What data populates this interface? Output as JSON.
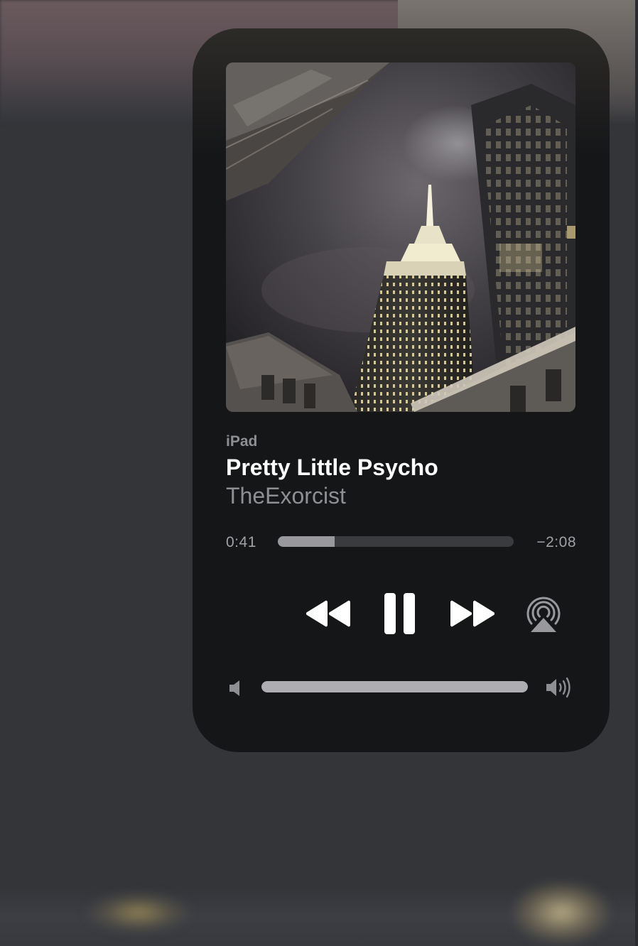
{
  "now_playing": {
    "device": "iPad",
    "title": "Pretty Little Psycho",
    "artist": "TheExorcist",
    "artwork": "night-skyscraper-photo"
  },
  "playback": {
    "elapsed": "0:41",
    "remaining": "−2:08",
    "progress_fraction": 0.24,
    "state": "playing"
  },
  "controls": {
    "rewind_icon": "rewind-icon",
    "pause_icon": "pause-icon",
    "forward_icon": "fast-forward-icon",
    "airplay_icon": "airplay-audio-icon"
  },
  "volume": {
    "level_fraction": 1.0,
    "min_icon": "speaker-low-icon",
    "max_icon": "speaker-high-icon"
  },
  "colors": {
    "panel_background": "#151618",
    "title_text": "#ffffff",
    "secondary_text": "#8e8e93",
    "track_background": "#3a3b3f",
    "track_fill": "#98989d"
  }
}
